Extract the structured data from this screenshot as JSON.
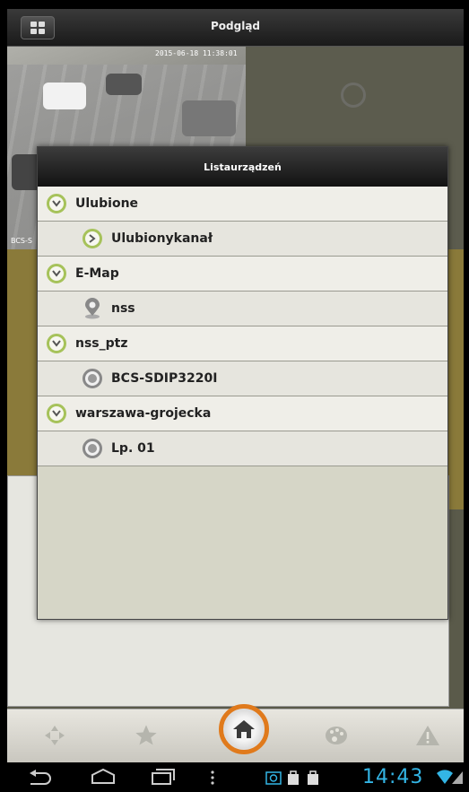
{
  "topbar": {
    "title": "Podgląd"
  },
  "camera": {
    "timestamp": "2015-06-18 11:38:01",
    "label": "BCS-S"
  },
  "dialog": {
    "title": "Listaurządzeń",
    "rows": [
      {
        "label": "Ulubione",
        "level": "parent",
        "icon": "chevron-down-icon"
      },
      {
        "label": "Ulubionykanał",
        "level": "child",
        "icon": "chevron-right-icon"
      },
      {
        "label": "E-Map",
        "level": "parent",
        "icon": "chevron-down-icon"
      },
      {
        "label": "nss",
        "level": "child",
        "icon": "map-pin-icon"
      },
      {
        "label": "nss_ptz",
        "level": "parent",
        "icon": "chevron-down-icon"
      },
      {
        "label": "BCS-SDIP3220I",
        "level": "child",
        "icon": "camera-dot-icon"
      },
      {
        "label": "warszawa-grojecka",
        "level": "parent",
        "icon": "chevron-down-icon"
      },
      {
        "label": "Lp. 01",
        "level": "child",
        "icon": "camera-dot-icon"
      }
    ]
  },
  "statusbar": {
    "time": "14:43"
  },
  "colors": {
    "accent_green": "#a6c25a",
    "home_ring": "#e07a1c",
    "clock": "#33b5e5"
  }
}
